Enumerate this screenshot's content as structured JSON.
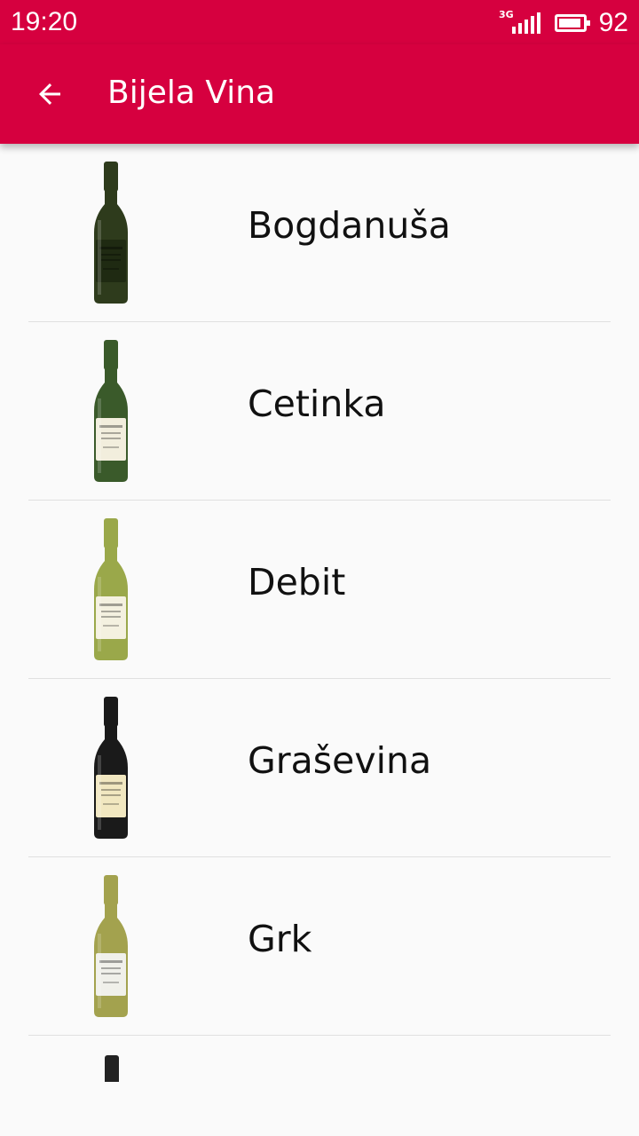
{
  "status_bar": {
    "time": "19:20",
    "network": "3G",
    "signal_icon": "signal-bars-icon",
    "battery_icon": "battery-icon",
    "battery_level": 92,
    "battery_percent": "92"
  },
  "app_bar": {
    "title": "Bijela Vina",
    "back_icon": "arrow-back-icon",
    "background_color": "#d6003f"
  },
  "wines": [
    {
      "name": "Bogdanuša",
      "bottle_color": "#2e3b1c",
      "label_color": "#1f2a12"
    },
    {
      "name": "Cetinka",
      "bottle_color": "#3a5a2a",
      "label_color": "#f2eedd"
    },
    {
      "name": "Debit",
      "bottle_color": "#9aa84a",
      "label_color": "#f4f1e0"
    },
    {
      "name": "Graševina",
      "bottle_color": "#1a1a1a",
      "label_color": "#f1e7c0"
    },
    {
      "name": "Grk",
      "bottle_color": "#a3a24e",
      "label_color": "#f0f0ea"
    }
  ]
}
